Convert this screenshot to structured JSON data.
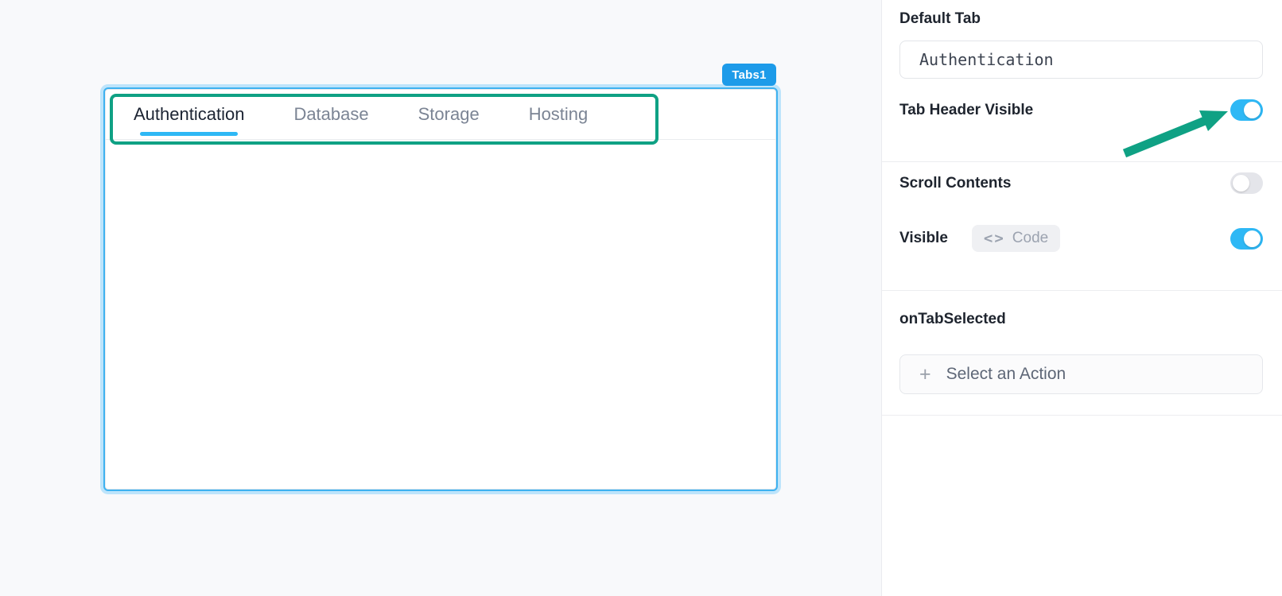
{
  "colors": {
    "canvas_bg": "#F8F9FB",
    "accent_blue": "#2EB8F5",
    "selection_blue": "#3EB2F0",
    "selection_halo": "#BDE4FB",
    "badge_blue": "#1D9BE9",
    "annotation_teal": "#0FA184",
    "toggle_off": "#E4E5EA"
  },
  "canvas": {
    "widget": {
      "badge": "Tabs1",
      "tabs": [
        {
          "label": "Authentication",
          "active": true
        },
        {
          "label": "Database",
          "active": false
        },
        {
          "label": "Storage",
          "active": false
        },
        {
          "label": "Hosting",
          "active": false
        }
      ]
    }
  },
  "panel": {
    "default_tab": {
      "label": "Default Tab",
      "value": "Authentication"
    },
    "tab_header_visible": {
      "label": "Tab Header Visible",
      "on": true
    },
    "scroll_contents": {
      "label": "Scroll Contents",
      "on": false
    },
    "visible": {
      "label": "Visible",
      "code_icon": "<>",
      "code_label": "Code",
      "on": true
    },
    "on_tab_selected": {
      "label": "onTabSelected",
      "plus_icon": "+",
      "action_label": "Select an Action"
    }
  }
}
